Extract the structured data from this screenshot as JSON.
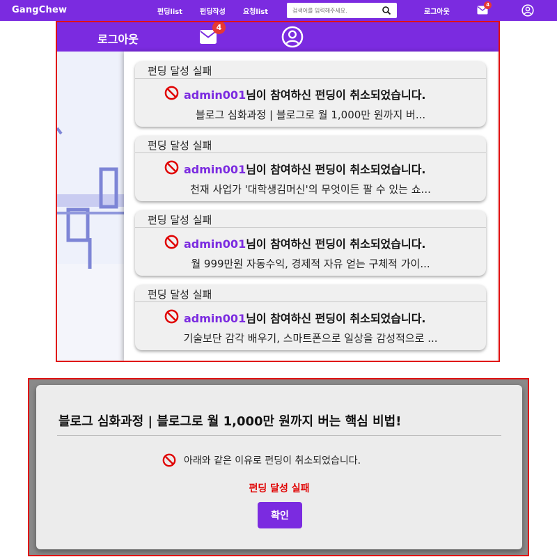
{
  "navbar": {
    "brand": "GangChew",
    "links": [
      "펀딩list",
      "펀딩작성",
      "요청list"
    ],
    "search_placeholder": "검색어를 입력해주세요.",
    "logout": "로그아웃",
    "mail_count": "4"
  },
  "dropdown_header": {
    "logout": "로그아웃",
    "mail_count": "4"
  },
  "notifications": [
    {
      "title": "펀딩 달성 실패",
      "user": "admin001",
      "message": "님이 참여하신 펀딩이 취소되었습니다.",
      "funding": "블로그 심화과정 | 블로그로 월 1,000만 원까지 버..."
    },
    {
      "title": "펀딩 달성 실패",
      "user": "admin001",
      "message": "님이 참여하신 펀딩이 취소되었습니다.",
      "funding": "천재 사업가 '대학생김머신'의 무엇이든 팔 수 있는 쇼..."
    },
    {
      "title": "펀딩 달성 실패",
      "user": "admin001",
      "message": "님이 참여하신 펀딩이 취소되었습니다.",
      "funding": "월 999만원 자동수익, 경제적 자유 얻는 구체적 가이..."
    },
    {
      "title": "펀딩 달성 실패",
      "user": "admin001",
      "message": "님이 참여하신 펀딩이 취소되었습니다.",
      "funding": "기술보단 감각 배우기, 스마트폰으로 일상을 감성적으로 ..."
    }
  ],
  "modal": {
    "title": "블로그 심화과정 | 블로그로 월 1,000만 원까지 버는 핵심 비법!",
    "message": "아래와 같은 이유로 펀딩이 취소되었습니다.",
    "reason": "펀딩 달성 실패",
    "confirm": "확인"
  },
  "colors": {
    "brand_purple": "#7b2be0",
    "badge_red": "#e53935",
    "highlight_border": "#e01010",
    "reason_red": "#e00000"
  }
}
